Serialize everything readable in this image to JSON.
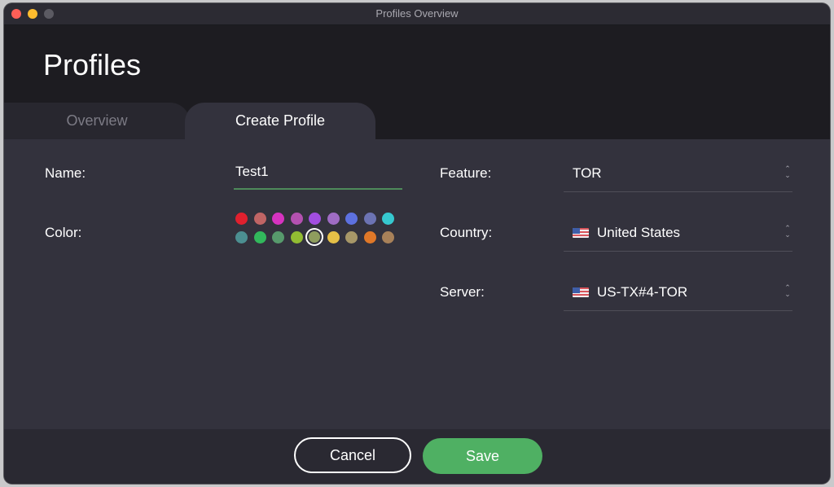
{
  "window": {
    "title": "Profiles Overview",
    "controls": [
      "close",
      "minimize",
      "maximize"
    ]
  },
  "header": {
    "title": "Profiles"
  },
  "tabs": [
    {
      "label": "Overview",
      "active": false
    },
    {
      "label": "Create Profile",
      "active": true
    }
  ],
  "form": {
    "name_label": "Name:",
    "name_value": "Test1",
    "color_label": "Color:",
    "colors": [
      "#e0202e",
      "#c06565",
      "#d633c0",
      "#b451b0",
      "#a24ee0",
      "#9f6cc4",
      "#5d71e0",
      "#6c73b3",
      "#36c8cf",
      "#4c8f91",
      "#32b85c",
      "#579a6c",
      "#92bc32",
      "#8f9d5e",
      "#e6c047",
      "#a79768",
      "#e07828",
      "#a88159"
    ],
    "selected_color_index": 13,
    "feature_label": "Feature:",
    "feature_value": "TOR",
    "country_label": "Country:",
    "country_value": "United States",
    "country_flag": "us-flag-icon",
    "server_label": "Server:",
    "server_value": "US-TX#4-TOR",
    "server_flag": "us-flag-icon"
  },
  "footer": {
    "cancel_label": "Cancel",
    "save_label": "Save"
  },
  "colors": {
    "accent": "#4fb063",
    "header_bg": "#1d1c21",
    "panel_bg": "#33323d"
  }
}
